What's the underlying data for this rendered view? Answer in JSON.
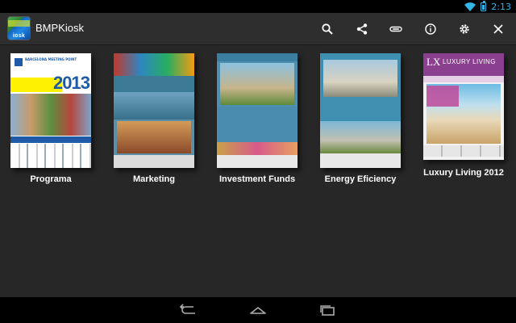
{
  "status_bar": {
    "time": "2:13",
    "wifi_icon": "wifi-icon",
    "battery_icon": "battery-icon",
    "accent_color": "#33b5e5"
  },
  "action_bar": {
    "app_title": "BMPKiosk",
    "app_icon_text": "iosk",
    "actions": [
      {
        "name": "search-icon"
      },
      {
        "name": "share-icon"
      },
      {
        "name": "attach-icon"
      },
      {
        "name": "info-icon"
      },
      {
        "name": "settings-icon"
      },
      {
        "name": "close-icon"
      }
    ]
  },
  "shelf": {
    "items": [
      {
        "label": "Programa",
        "cover": "programa"
      },
      {
        "label": "Marketing",
        "cover": "marketing"
      },
      {
        "label": "Investment Funds",
        "cover": "investment"
      },
      {
        "label": "Energy Eficiency",
        "cover": "energy"
      },
      {
        "label": "Luxury Living 2012",
        "cover": "luxury"
      }
    ],
    "programa_cover": {
      "year": "2013",
      "logo_text": "BARCELONA MEETING POINT"
    },
    "luxury_cover": {
      "head_lx": "LX",
      "head_title": "LUXURY LIVING"
    }
  },
  "nav_bar": {
    "buttons": [
      {
        "name": "back-icon"
      },
      {
        "name": "home-icon"
      },
      {
        "name": "recent-apps-icon"
      }
    ]
  }
}
